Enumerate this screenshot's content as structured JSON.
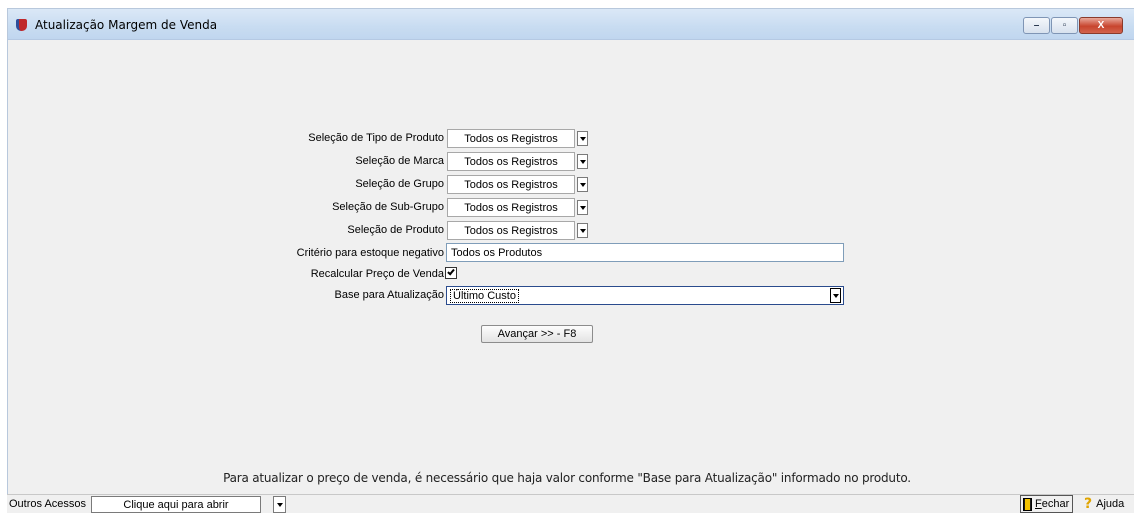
{
  "window": {
    "title": "Atualização Margem de Venda",
    "controls": {
      "minimize": "–",
      "maximize": "▫",
      "close": "X"
    }
  },
  "form": {
    "filters": [
      {
        "label": "Seleção de Tipo de Produto",
        "value": "Todos os Registros"
      },
      {
        "label": "Seleção de Marca",
        "value": "Todos os Registros"
      },
      {
        "label": "Seleção de Grupo",
        "value": "Todos os Registros"
      },
      {
        "label": "Seleção de Sub-Grupo",
        "value": "Todos os Registros"
      },
      {
        "label": "Seleção de Produto",
        "value": "Todos os Registros"
      }
    ],
    "criterio": {
      "label": "Critério para estoque negativo",
      "value": "Todos os Produtos"
    },
    "recalcular": {
      "label": "Recalcular Preço de Venda",
      "checked": true
    },
    "base": {
      "label": "Base para Atualização",
      "value": "Último Custo"
    },
    "advance_button": "Avançar >> - F8"
  },
  "info_text": "Para atualizar o preço de venda, é necessário que haja valor conforme \"Base para Atualização\" informado no produto.",
  "bottom": {
    "outros_label": "Outros Acessos",
    "outros_value": "Clique aqui para abrir",
    "fechar_first": "F",
    "fechar_rest": "echar",
    "ajuda": "Ajuda"
  }
}
